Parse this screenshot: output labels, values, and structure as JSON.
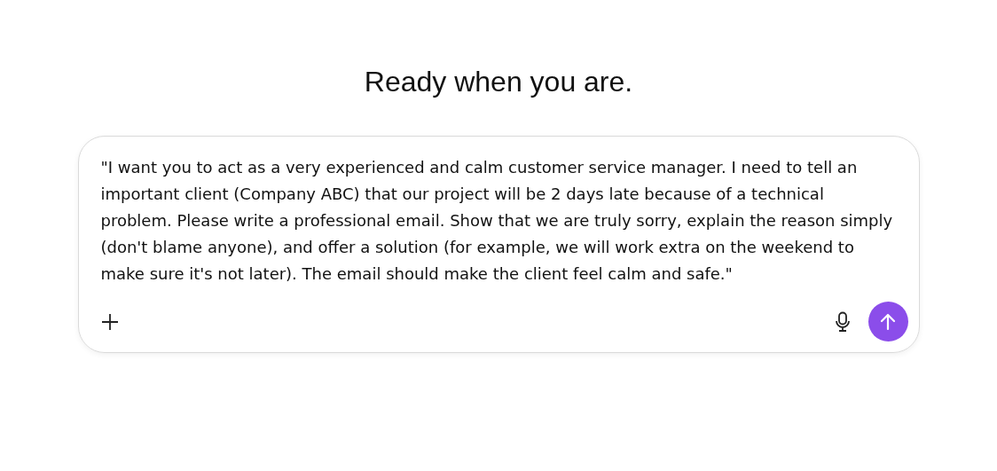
{
  "heading": "Ready when you are.",
  "composer": {
    "value": "\"I want you to act as a very experienced and calm customer service manager. I need to tell an important client (Company ABC) that our project will be 2 days late because of a technical problem. Please write a professional email. Show that we are truly sorry, explain the reason simply (don't blame anyone), and offer a solution (for example, we will work extra on the weekend to make sure it's not later). The email should make the client feel calm and safe.\""
  }
}
